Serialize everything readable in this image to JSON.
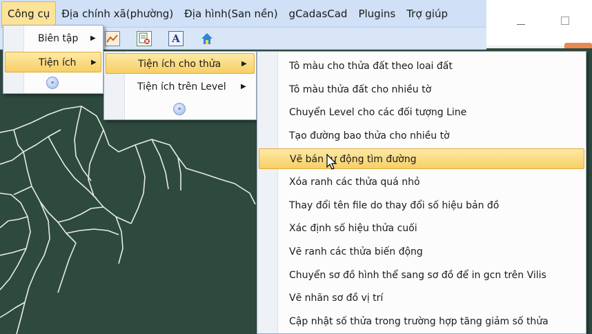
{
  "menubar": {
    "items": [
      {
        "label": "Công cụ",
        "active": true
      },
      {
        "label": "Địa chính xã(phường)"
      },
      {
        "label": "Địa hình(San nền)"
      },
      {
        "label": "gCadasCad"
      },
      {
        "label": "Plugins"
      },
      {
        "label": "Trợ giúp"
      }
    ]
  },
  "toolbar": {
    "icons": [
      "chart-icon",
      "excel-delete-icon",
      "text-icon",
      "house-icon"
    ],
    "text_icon_glyph": "A"
  },
  "menu_level1": {
    "items": [
      {
        "label": "Biên tập",
        "has_submenu": true
      },
      {
        "label": "Tiện ích",
        "has_submenu": true,
        "highlighted": true
      }
    ],
    "expand": "»"
  },
  "menu_level2": {
    "items": [
      {
        "label": "Tiện ích cho thửa",
        "has_submenu": true,
        "highlighted": true
      },
      {
        "label": "Tiện ích trên Level",
        "has_submenu": true
      }
    ],
    "expand": "»"
  },
  "menu_level3": {
    "items": [
      {
        "label": "Tô màu cho thửa đất theo loai đất"
      },
      {
        "label": "Tô màu thửa đất cho nhiều tờ"
      },
      {
        "label": "Chuyển Level cho các đối tượng Line"
      },
      {
        "label": "Tạo đường bao thửa cho nhiều tờ"
      },
      {
        "label": "Vẽ bán tự động tìm đường",
        "highlighted": true
      },
      {
        "label": "Xóa ranh các thửa quá nhỏ"
      },
      {
        "label": "Thay đổi tên file do thay đổi số hiệu bản đồ"
      },
      {
        "label": "Xác định số hiệu thửa cuối"
      },
      {
        "label": "Vẽ ranh các thửa biến động"
      },
      {
        "label": "Chuyển sơ đồ hình thể sang sơ đồ để in gcn trên Vilis"
      },
      {
        "label": "Vẽ nhãn sơ đồ vị trí"
      },
      {
        "label": "Cập nhật số thửa trong trường hợp tăng giảm số thửa"
      }
    ]
  },
  "arrow_glyph": "▶",
  "colors": {
    "menubar_bg": "#cfe0f7",
    "highlight": "#f7cf65",
    "canvas": "#2e4a3f"
  }
}
